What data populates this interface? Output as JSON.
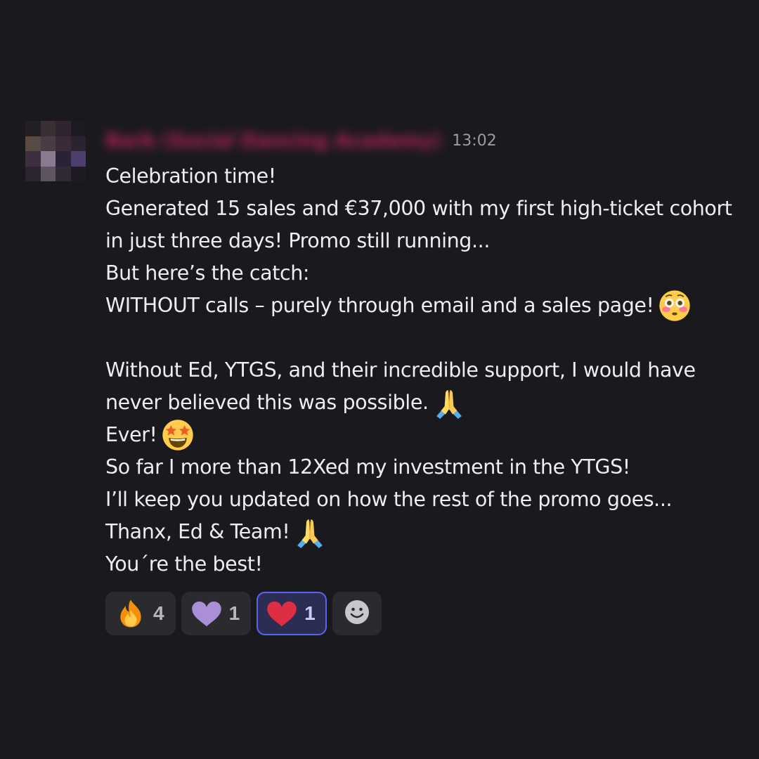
{
  "message": {
    "author": "Barb (Social Dancing Academy)",
    "timestamp": "13:02",
    "lines": [
      {
        "text": "Celebration time!",
        "emoji": ""
      },
      {
        "text": "Generated 15 sales and €37,000 with my first high-ticket cohort",
        "emoji": ""
      },
      {
        "text": "in just three days! Promo still running...",
        "emoji": ""
      },
      {
        "text": "But here’s the catch:",
        "emoji": ""
      },
      {
        "text": "WITHOUT  calls – purely through email and a sales page!",
        "emoji": "flushed-face-emoji"
      },
      {
        "text": "",
        "emoji": ""
      },
      {
        "text": "Without Ed, YTGS, and their incredible support, I would have",
        "emoji": ""
      },
      {
        "text": "never believed this was possible.",
        "emoji": "folded-hands-emoji"
      },
      {
        "text": "Ever!",
        "emoji": "star-struck-emoji"
      },
      {
        "text": "So far I more than 12Xed my  investment in the YTGS!",
        "emoji": ""
      },
      {
        "text": "I’ll keep you updated on how the rest of the promo goes...",
        "emoji": ""
      },
      {
        "text": "Thanx, Ed & Team!",
        "emoji": "folded-hands-emoji"
      },
      {
        "text": "You´re the best!",
        "emoji": ""
      }
    ]
  },
  "reactions": [
    {
      "icon": "fire-emoji",
      "count": "4",
      "active": false
    },
    {
      "icon": "purple-heart-emoji",
      "count": "1",
      "active": false
    },
    {
      "icon": "red-heart-emoji",
      "count": "1",
      "active": true
    }
  ],
  "add_reaction": {
    "icon": "smiley-add-reaction-icon"
  },
  "colors": {
    "background": "#1a1a1e",
    "username": "#d6245f",
    "timestamp": "#9a9ca3",
    "text": "#eceef1",
    "reaction_bg": "#2a2a2f",
    "reaction_active_border": "#5865f2"
  },
  "avatar": {
    "pixels": [
      "#241f24",
      "#3a2f35",
      "#302430",
      "#1d1a22",
      "#5a4a44",
      "#4a3b45",
      "#3a2b38",
      "#2a2330",
      "#3c3040",
      "#8b7a8f",
      "#2b2138",
      "#4c3f6e",
      "#2a2530",
      "#5f5560",
      "#302a34",
      "#1e1b22"
    ]
  }
}
